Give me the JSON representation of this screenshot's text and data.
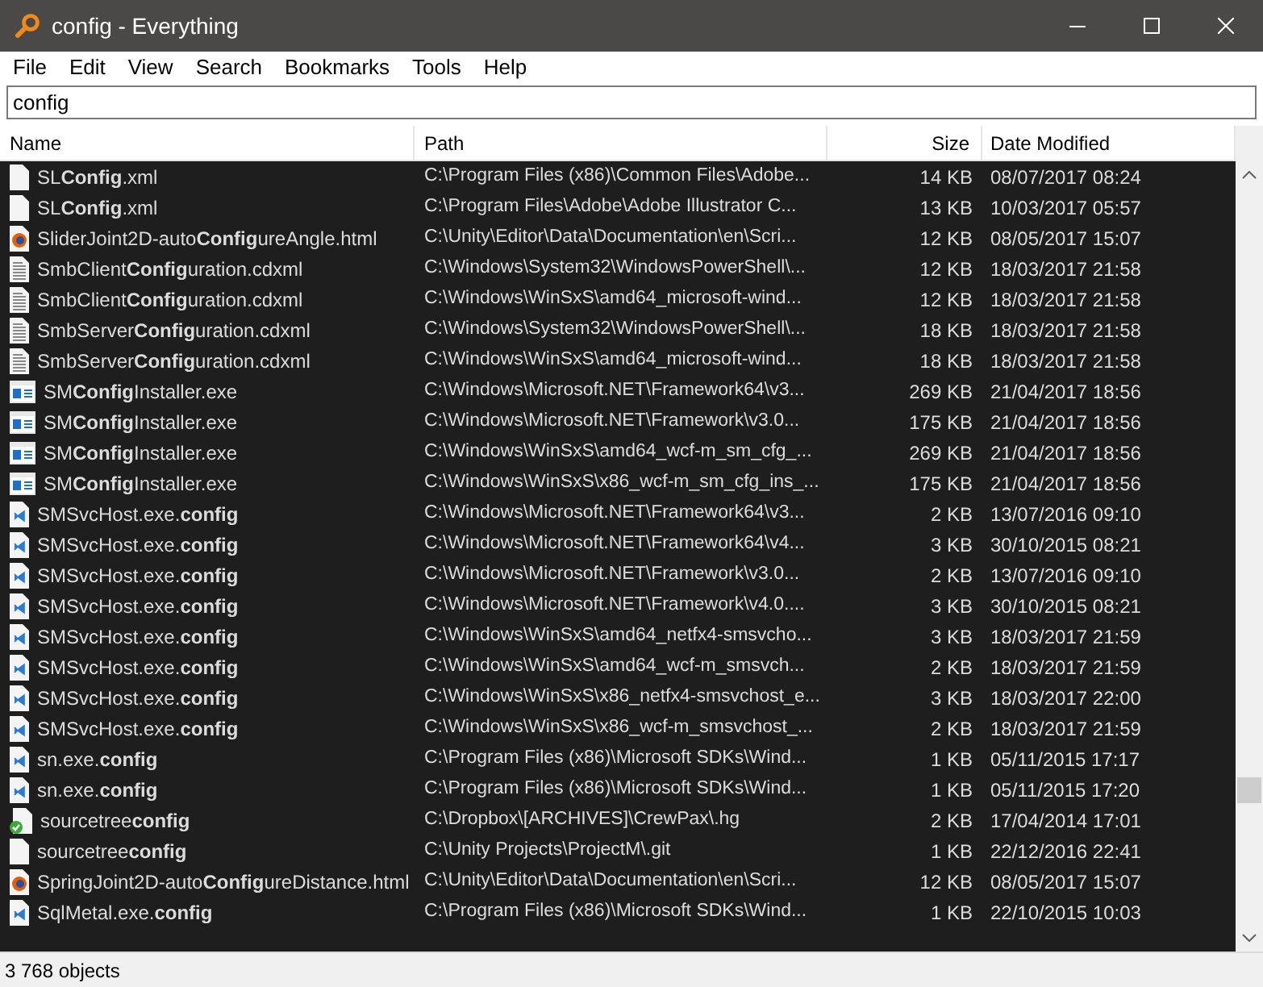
{
  "window": {
    "title": "config - Everything"
  },
  "menu": [
    "File",
    "Edit",
    "View",
    "Search",
    "Bookmarks",
    "Tools",
    "Help"
  ],
  "search": {
    "value": "config"
  },
  "columns": [
    "Name",
    "Path",
    "Size",
    "Date Modified"
  ],
  "rows": [
    {
      "kind": "blank",
      "name": "SL**Config**.xml",
      "path": "C:\\Program Files (x86)\\Common Files\\Adobe...",
      "size": "14 KB",
      "date": "08/07/2017 08:24"
    },
    {
      "kind": "blank",
      "name": "SL**Config**.xml",
      "path": "C:\\Program Files\\Adobe\\Adobe Illustrator C...",
      "size": "13 KB",
      "date": "10/03/2017 05:57"
    },
    {
      "kind": "browser",
      "name": "SliderJoint2D-auto**Config**ureAngle.html",
      "path": "C:\\Unity\\Editor\\Data\\Documentation\\en\\Scri...",
      "size": "12 KB",
      "date": "08/05/2017 15:07"
    },
    {
      "kind": "text",
      "name": "SmbClient**Config**uration.cdxml",
      "path": "C:\\Windows\\System32\\WindowsPowerShell\\...",
      "size": "12 KB",
      "date": "18/03/2017 21:58"
    },
    {
      "kind": "text",
      "name": "SmbClient**Config**uration.cdxml",
      "path": "C:\\Windows\\WinSxS\\amd64_microsoft-wind...",
      "size": "12 KB",
      "date": "18/03/2017 21:58"
    },
    {
      "kind": "text",
      "name": "SmbServer**Config**uration.cdxml",
      "path": "C:\\Windows\\System32\\WindowsPowerShell\\...",
      "size": "18 KB",
      "date": "18/03/2017 21:58"
    },
    {
      "kind": "text",
      "name": "SmbServer**Config**uration.cdxml",
      "path": "C:\\Windows\\WinSxS\\amd64_microsoft-wind...",
      "size": "18 KB",
      "date": "18/03/2017 21:58"
    },
    {
      "kind": "exe",
      "name": "SM**Config**Installer.exe",
      "path": "C:\\Windows\\Microsoft.NET\\Framework64\\v3...",
      "size": "269 KB",
      "date": "21/04/2017 18:56"
    },
    {
      "kind": "exe",
      "name": "SM**Config**Installer.exe",
      "path": "C:\\Windows\\Microsoft.NET\\Framework\\v3.0...",
      "size": "175 KB",
      "date": "21/04/2017 18:56"
    },
    {
      "kind": "exe",
      "name": "SM**Config**Installer.exe",
      "path": "C:\\Windows\\WinSxS\\amd64_wcf-m_sm_cfg_...",
      "size": "269 KB",
      "date": "21/04/2017 18:56"
    },
    {
      "kind": "exe",
      "name": "SM**Config**Installer.exe",
      "path": "C:\\Windows\\WinSxS\\x86_wcf-m_sm_cfg_ins_...",
      "size": "175 KB",
      "date": "21/04/2017 18:56"
    },
    {
      "kind": "code",
      "name": "SMSvcHost.exe.**config**",
      "path": "C:\\Windows\\Microsoft.NET\\Framework64\\v3...",
      "size": "2 KB",
      "date": "13/07/2016 09:10"
    },
    {
      "kind": "code",
      "name": "SMSvcHost.exe.**config**",
      "path": "C:\\Windows\\Microsoft.NET\\Framework64\\v4...",
      "size": "3 KB",
      "date": "30/10/2015 08:21"
    },
    {
      "kind": "code",
      "name": "SMSvcHost.exe.**config**",
      "path": "C:\\Windows\\Microsoft.NET\\Framework\\v3.0...",
      "size": "2 KB",
      "date": "13/07/2016 09:10"
    },
    {
      "kind": "code",
      "name": "SMSvcHost.exe.**config**",
      "path": "C:\\Windows\\Microsoft.NET\\Framework\\v4.0....",
      "size": "3 KB",
      "date": "30/10/2015 08:21"
    },
    {
      "kind": "code",
      "name": "SMSvcHost.exe.**config**",
      "path": "C:\\Windows\\WinSxS\\amd64_netfx4-smsvcho...",
      "size": "3 KB",
      "date": "18/03/2017 21:59"
    },
    {
      "kind": "code",
      "name": "SMSvcHost.exe.**config**",
      "path": "C:\\Windows\\WinSxS\\amd64_wcf-m_smsvch...",
      "size": "2 KB",
      "date": "18/03/2017 21:59"
    },
    {
      "kind": "code",
      "name": "SMSvcHost.exe.**config**",
      "path": "C:\\Windows\\WinSxS\\x86_netfx4-smsvchost_e...",
      "size": "3 KB",
      "date": "18/03/2017 22:00"
    },
    {
      "kind": "code",
      "name": "SMSvcHost.exe.**config**",
      "path": "C:\\Windows\\WinSxS\\x86_wcf-m_smsvchost_...",
      "size": "2 KB",
      "date": "18/03/2017 21:59"
    },
    {
      "kind": "code",
      "name": "sn.exe.**config**",
      "path": "C:\\Program Files (x86)\\Microsoft SDKs\\Wind...",
      "size": "1 KB",
      "date": "05/11/2015 17:17"
    },
    {
      "kind": "code",
      "name": "sn.exe.**config**",
      "path": "C:\\Program Files (x86)\\Microsoft SDKs\\Wind...",
      "size": "1 KB",
      "date": "05/11/2015 17:20"
    },
    {
      "kind": "synced",
      "name": "sourcetree**config**",
      "path": "C:\\Dropbox\\[ARCHIVES]\\CrewPax\\.hg",
      "size": "2 KB",
      "date": "17/04/2014 17:01"
    },
    {
      "kind": "blank",
      "name": "sourcetree**config**",
      "path": "C:\\Unity Projects\\ProjectM\\.git",
      "size": "1 KB",
      "date": "22/12/2016 22:41"
    },
    {
      "kind": "browser",
      "name": "SpringJoint2D-auto**Config**ureDistance.html",
      "path": "C:\\Unity\\Editor\\Data\\Documentation\\en\\Scri...",
      "size": "12 KB",
      "date": "08/05/2017 15:07"
    },
    {
      "kind": "code",
      "name": "SqlMetal.exe.**config**",
      "path": "C:\\Program Files (x86)\\Microsoft SDKs\\Wind...",
      "size": "1 KB",
      "date": "22/10/2015 10:03"
    }
  ],
  "status_bar": "3 768 objects"
}
